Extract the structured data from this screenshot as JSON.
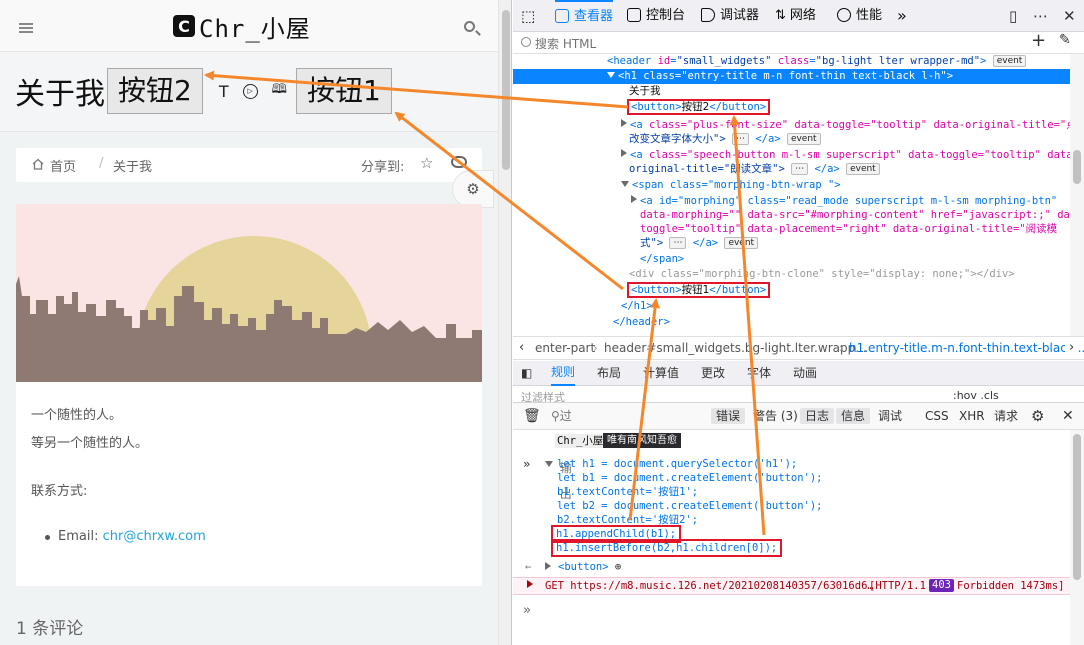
{
  "page": {
    "logo_mark": "C",
    "logo_text": "Chr_小屋",
    "h1_text": "关于我",
    "button2_label": "按钮2",
    "button1_label": "按钮1",
    "tool_font_size": "T",
    "tool_speech": "▷",
    "tool_read": "📖",
    "breadcrumb": {
      "home": "首页",
      "sep": "/",
      "current": "关于我"
    },
    "share_label": "分享到:",
    "body_lines": [
      "一个随性的人。",
      "等另一个随性的人。",
      "联系方式:"
    ],
    "email_label": "Email:",
    "email_value": "chr@chrxw.com",
    "comments": "1 条评论"
  },
  "devtools": {
    "tabs": [
      "查看器",
      "控制台",
      "调试器",
      "网络",
      "性能"
    ],
    "more": "»",
    "search_placeholder": "搜索 HTML",
    "tree": {
      "l1_tag": "<header",
      "l1_attrs": [
        [
          "id",
          "small_widgets"
        ],
        [
          "class",
          "bg-light lter wrapper-md"
        ]
      ],
      "l2_tag": "<h1",
      "l2_attrs": [
        [
          "class",
          "entry-title m-n font-thin text-black l-h"
        ]
      ],
      "text_about": "关于我",
      "btn2_open": "<button>",
      "btn2_text": "按钮2",
      "btn2_close": "</button>",
      "a1": "<a",
      "a1_attrs": "class=\"plus-font-size\" data-toggle=\"tooltip\" data-original-title=\"点击",
      "a1_cont": "改变文章字体大小\">",
      "a1_end": "</a>",
      "a2": "<a",
      "a2_attrs": "class=\"speech-button m-l-sm superscript\" data-toggle=\"tooltip\" data-",
      "a2_cont": "original-title=\"朗读文章\">",
      "a2_end": "</a>",
      "span_open": "<span class=\"morphing-btn-wrap \">",
      "a3": "<a id=\"morphing\" class=\"read_mode superscript m-l-sm morphing-btn\"",
      "a3_b": "data-morphing=\"\" data-src=\"#morphing-content\" href=\"javascript:;\" data-",
      "a3_c": "toggle=\"tooltip\" data-placement=\"right\" data-original-title=\"阅读模",
      "a3_d": "式\">",
      "a3_end": "</a>",
      "span_close": "</span>",
      "div_clone": "<div class=\"morphing-btn-clone\" style=\"display: none;\"></div>",
      "btn1_open": "<button>",
      "btn1_text": "按钮1",
      "btn1_close": "</button>",
      "h1_close": "</h1>",
      "header_close": "</header>",
      "event": "event",
      "ellipsis": "⋯"
    },
    "breadcrumbs": [
      "enter-part",
      "header#small_widgets.bg-light.lter.wrapp...",
      "h1.entry-title.m-n.font-thin.text-black..."
    ],
    "rule_tabs": [
      "规则",
      "布局",
      "计算值",
      "更改",
      "字体",
      "动画"
    ],
    "rule_filter": "过滤样式",
    "rule_right": ":hov  .cls",
    "console_filter": "过滤输出",
    "console_levels": [
      "错误",
      "警告 (3)",
      "日志",
      "信息",
      "调试"
    ],
    "console_types": [
      "CSS",
      "XHR",
      "请求"
    ],
    "console_top": "Chr_小屋",
    "tooltip": "唯有南风知吾愈",
    "code": [
      "let h1 = document.querySelector('h1');",
      "let b1 = document.createElement('button');",
      "b1.textContent='按钮1';",
      "let b2 = document.createElement('button');",
      "b2.textContent='按钮2';",
      "h1.appendChild(b1);",
      "h1.insertBefore(b2,h1.children[0]);"
    ],
    "result": "<button>",
    "error_line": "GET https://m8.music.126.net/20210208140357/63016d6…",
    "error_status": "[HTTP/1.1",
    "error_code": "403",
    "error_tail": "Forbidden 1473ms]",
    "prompt": "»"
  },
  "colors": {
    "accent": "#0a84ff",
    "arrow": "#f5862a",
    "highlight": "#e0162b",
    "link": "#23a4d8"
  }
}
